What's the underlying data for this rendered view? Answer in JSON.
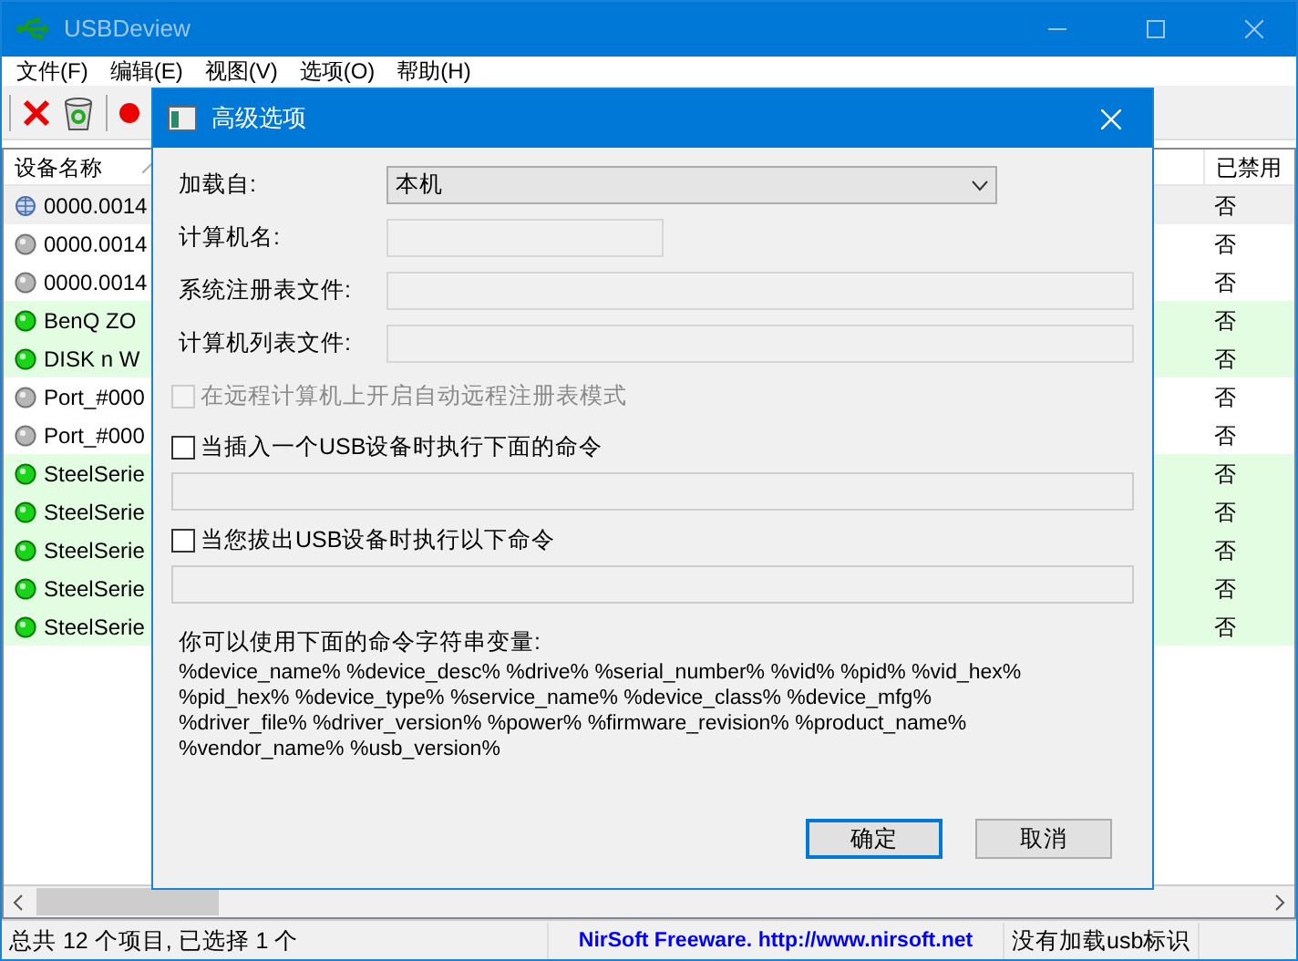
{
  "window": {
    "title": "USBDeview"
  },
  "menu": [
    "文件(F)",
    "编辑(E)",
    "视图(V)",
    "选项(O)",
    "帮助(H)"
  ],
  "columns": [
    "设备名称",
    "已禁用"
  ],
  "rows": [
    {
      "device_name": "0000.0014",
      "kind": "hub",
      "disabled": "否",
      "selected": true
    },
    {
      "device_name": "0000.0014",
      "kind": "off",
      "disabled": "否",
      "selected": false
    },
    {
      "device_name": "0000.0014",
      "kind": "off",
      "disabled": "否",
      "selected": false
    },
    {
      "device_name": "BenQ ZO",
      "kind": "on",
      "disabled": "否",
      "selected": false
    },
    {
      "device_name": "DISK  n W",
      "kind": "on",
      "disabled": "否",
      "selected": false
    },
    {
      "device_name": "Port_#000",
      "kind": "off",
      "disabled": "否",
      "selected": false
    },
    {
      "device_name": "Port_#000",
      "kind": "off",
      "disabled": "否",
      "selected": false
    },
    {
      "device_name": "SteelSerie",
      "kind": "on",
      "disabled": "否",
      "selected": false
    },
    {
      "device_name": "SteelSerie",
      "kind": "on",
      "disabled": "否",
      "selected": false
    },
    {
      "device_name": "SteelSerie",
      "kind": "on",
      "disabled": "否",
      "selected": false
    },
    {
      "device_name": "SteelSerie",
      "kind": "on",
      "disabled": "否",
      "selected": false
    },
    {
      "device_name": "SteelSerie",
      "kind": "on",
      "disabled": "否",
      "selected": false
    }
  ],
  "dialog": {
    "title": "高级选项",
    "fields": [
      {
        "label": "加载自:",
        "kind": "select",
        "value": "本机"
      },
      {
        "label": "计算机名:",
        "kind": "short"
      },
      {
        "label": "系统注册表文件:",
        "kind": "long"
      },
      {
        "label": "计算机列表文件:",
        "kind": "long"
      }
    ],
    "checkboxes": [
      {
        "label": "在远程计算机上开启自动远程注册表模式",
        "checked": false,
        "disabled": true,
        "command_field": false
      },
      {
        "label": "当插入一个USB设备时执行下面的命令",
        "checked": false,
        "disabled": false,
        "command_field": true
      },
      {
        "label": "当您拔出USB设备时执行以下命令",
        "checked": false,
        "disabled": false,
        "command_field": true
      }
    ],
    "variables_label": "你可以使用下面的命令字符串变量:",
    "variables": "%device_name%  %device_desc%  %drive%  %serial_number%  %vid% %pid% %vid_hex% %pid_hex% %device_type% %service_name% %device_class% %device_mfg% %driver_file% %driver_version% %power% %firmware_revision% %product_name% %vendor_name% %usb_version%",
    "buttons": [
      {
        "label": "确定",
        "default": true
      },
      {
        "label": "取消",
        "default": false
      }
    ]
  },
  "status_bar": [
    "总共 12 个项目, 已选择 1 个",
    "NirSoft Freeware.  http://www.nirsoft.net",
    "没有加载usb标识"
  ]
}
